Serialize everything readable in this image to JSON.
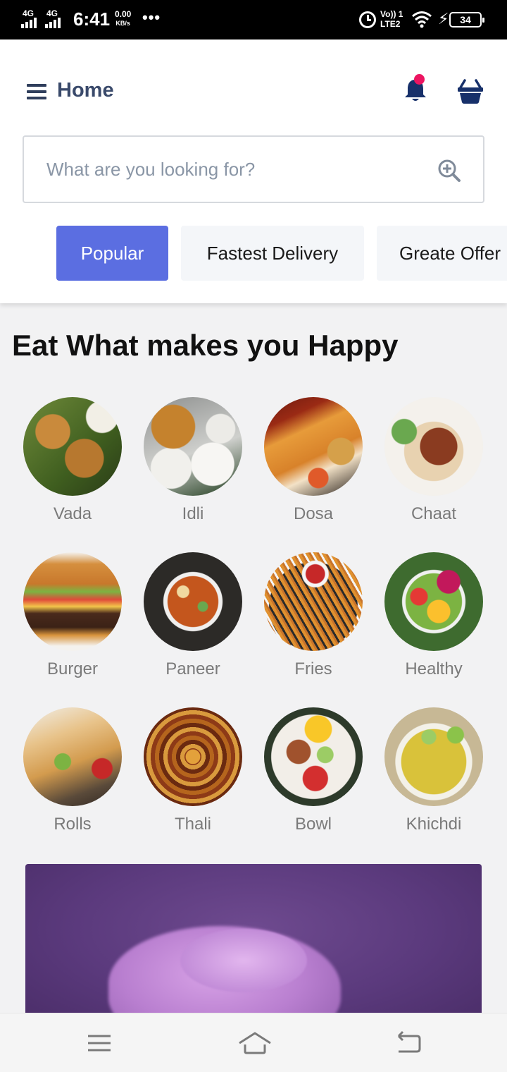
{
  "status_bar": {
    "network_1": "4G",
    "network_2": "4G",
    "time": "6:41",
    "speed_value": "0.00",
    "speed_unit": "KB/s",
    "more": "•••",
    "volte_line1": "Vo)) 1",
    "volte_line2": "LTE2",
    "battery": "34"
  },
  "header": {
    "title": "Home",
    "search_placeholder": "What are you looking for?",
    "chips": [
      "Popular",
      "Fastest Delivery",
      "Greate Offer"
    ]
  },
  "section": {
    "title": "Eat What makes you Happy"
  },
  "categories": [
    {
      "label": "Vada"
    },
    {
      "label": "Idli"
    },
    {
      "label": "Dosa"
    },
    {
      "label": "Chaat"
    },
    {
      "label": "Burger"
    },
    {
      "label": "Paneer"
    },
    {
      "label": "Fries"
    },
    {
      "label": "Healthy"
    },
    {
      "label": "Rolls"
    },
    {
      "label": "Thali"
    },
    {
      "label": "Bowl"
    },
    {
      "label": "Khichdi"
    }
  ],
  "colors": {
    "accent": "#5b6ee1",
    "notification_dot": "#ec1561",
    "header_text": "#3a4a6b"
  }
}
